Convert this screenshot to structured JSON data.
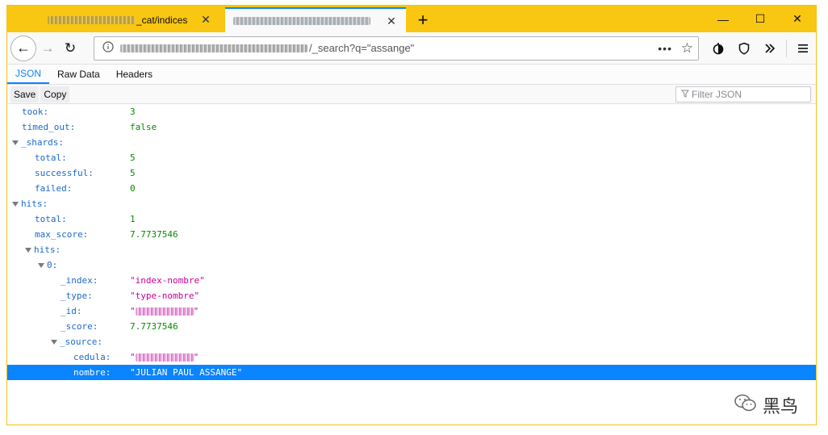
{
  "tabs": [
    {
      "label": "_cat/indices",
      "close": "✕"
    },
    {
      "label": "",
      "close": "✕"
    }
  ],
  "new_tab": "+",
  "window_controls": {
    "minimize": "—",
    "maximize": "☐",
    "close": "✕"
  },
  "nav": {
    "back": "←",
    "forward": "→",
    "reload": "↻",
    "url_suffix": "/_search?q=\"assange\"",
    "more": "•••",
    "star": "☆"
  },
  "viewer_tabs": [
    "JSON",
    "Raw Data",
    "Headers"
  ],
  "toolbar": {
    "save": "Save",
    "copy": "Copy",
    "filter_placeholder": "Filter JSON"
  },
  "tree": [
    {
      "key": "took:",
      "value": "3",
      "type": "num",
      "indent": 0,
      "expanded": null
    },
    {
      "key": "timed_out:",
      "value": "false",
      "type": "bool",
      "indent": 0,
      "expanded": null
    },
    {
      "key": "_shards:",
      "value": "",
      "type": "obj",
      "indent": 0,
      "expanded": true
    },
    {
      "key": "total:",
      "value": "5",
      "type": "num",
      "indent": 1,
      "expanded": null
    },
    {
      "key": "successful:",
      "value": "5",
      "type": "num",
      "indent": 1,
      "expanded": null
    },
    {
      "key": "failed:",
      "value": "0",
      "type": "num",
      "indent": 1,
      "expanded": null
    },
    {
      "key": "hits:",
      "value": "",
      "type": "obj",
      "indent": 0,
      "expanded": true
    },
    {
      "key": "total:",
      "value": "1",
      "type": "num",
      "indent": 1,
      "expanded": null
    },
    {
      "key": "max_score:",
      "value": "7.7737546",
      "type": "num",
      "indent": 1,
      "expanded": null
    },
    {
      "key": "hits:",
      "value": "",
      "type": "obj",
      "indent": 1,
      "expanded": true
    },
    {
      "key": "0:",
      "value": "",
      "type": "obj",
      "indent": 2,
      "expanded": true
    },
    {
      "key": "_index:",
      "value": "\"index-nombre\"",
      "type": "str",
      "indent": 3,
      "expanded": null
    },
    {
      "key": "_type:",
      "value": "\"type-nombre\"",
      "type": "str",
      "indent": 3,
      "expanded": null
    },
    {
      "key": "_id:",
      "value": "\"",
      "type": "str-redacted",
      "indent": 3,
      "expanded": null
    },
    {
      "key": "_score:",
      "value": "7.7737546",
      "type": "num",
      "indent": 3,
      "expanded": null
    },
    {
      "key": "_source:",
      "value": "",
      "type": "obj",
      "indent": 3,
      "expanded": true
    },
    {
      "key": "cedula:",
      "value": "\"",
      "type": "str-redacted",
      "indent": 4,
      "expanded": null
    },
    {
      "key": "nombre:",
      "value": "\"JULIAN PAUL ASSANGE\"",
      "type": "str",
      "indent": 4,
      "expanded": null,
      "selected": true
    }
  ],
  "watermark": {
    "icon": "wechat-icon",
    "text": "黑鸟"
  }
}
